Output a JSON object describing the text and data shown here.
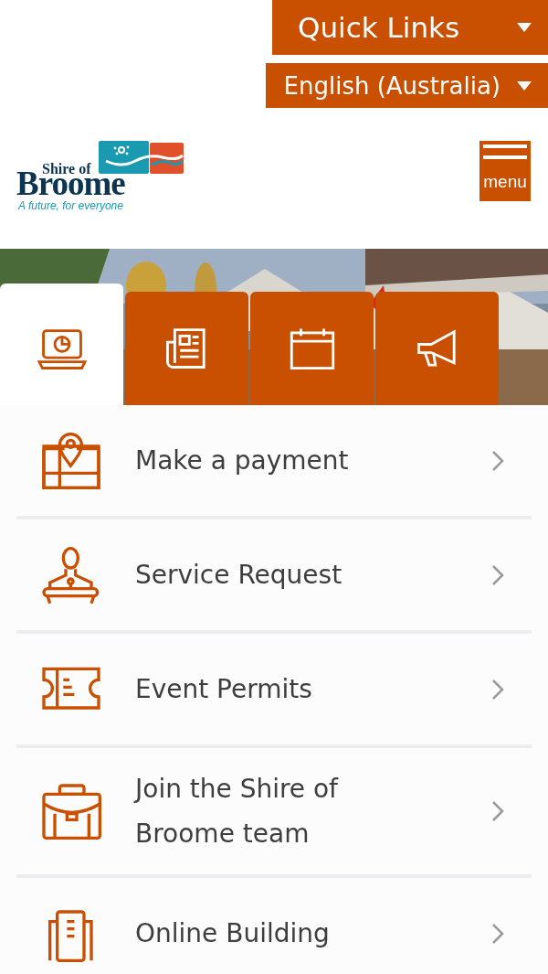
{
  "header": {
    "quick_links": "Quick Links",
    "language": "English (Australia)"
  },
  "logo": {
    "line_1": "Shire of",
    "line_2": "Broome",
    "tagline": "A future, for everyone"
  },
  "menu_button": "menu",
  "tabs": [
    {
      "selected": true
    },
    {
      "selected": false
    },
    {
      "selected": false
    },
    {
      "selected": false
    }
  ],
  "links": [
    {
      "label": "Make a payment"
    },
    {
      "label": "Service Request"
    },
    {
      "label": "Event Permits"
    },
    {
      "label": "Join the Shire of Broome team"
    },
    {
      "label": "Online Building"
    }
  ]
}
